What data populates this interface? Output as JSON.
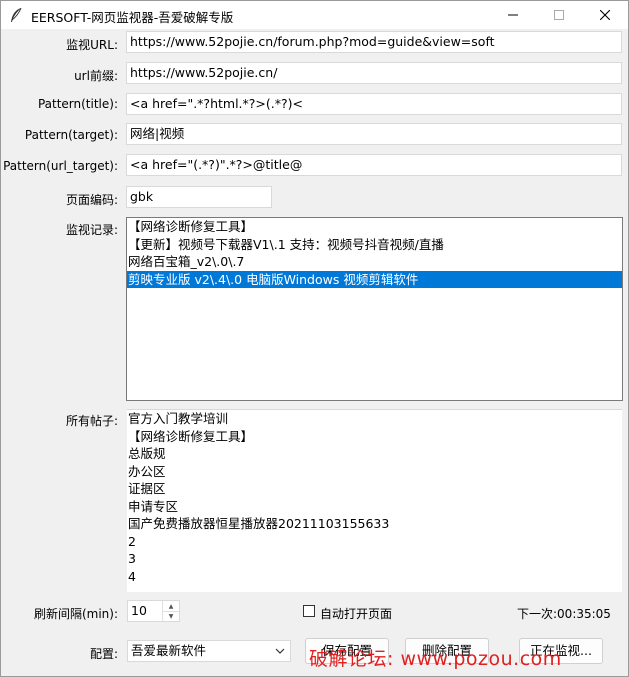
{
  "window": {
    "title": "EERSOFT-网页监视器-吾爱破解专版",
    "controls": {
      "minimize": "—",
      "maximize": "☐",
      "close": "✕"
    }
  },
  "form": {
    "monitor_url_label": "监视URL:",
    "monitor_url_value": "https://www.52pojie.cn/forum.php?mod=guide&view=soft",
    "url_prefix_label": "url前缀:",
    "url_prefix_value": "https://www.52pojie.cn/",
    "pattern_title_label": "Pattern(title):",
    "pattern_title_value": "<a href=\".*?html.*?>(.*?)<",
    "pattern_target_label": "Pattern(target):",
    "pattern_target_value": "网络|视频",
    "pattern_url_target_label": "Pattern(url_target):",
    "pattern_url_target_value": "<a href=\"(.*?)\".*?>@title@",
    "encoding_label": "页面编码:",
    "encoding_value": "gbk"
  },
  "records": {
    "label": "监视记录:",
    "items": [
      "【网络诊断修复工具】",
      "【更新】视频号下载器V1\\.1 支持：视频号抖音视频/直播",
      "网络百宝箱_v2\\.0\\.7",
      "剪映专业版 v2\\.4\\.0 电脑版Windows  视频剪辑软件"
    ],
    "selected_index": 3
  },
  "posts": {
    "label": "所有帖子:",
    "items": [
      "官方入门教学培训",
      "【网络诊断修复工具】",
      "总版规",
      "办公区",
      "证据区",
      "申请专区",
      "国产免费播放器恒星播放器20211103155633",
      "2",
      "3",
      "4"
    ]
  },
  "refresh": {
    "label": "刷新间隔(min):",
    "value": "10"
  },
  "auto_open": {
    "label": "自动打开页面",
    "checked": false
  },
  "next_run": "下一次:00:35:05",
  "config": {
    "label": "配置:",
    "selected": "吾爱最新软件"
  },
  "buttons": {
    "save": "保存配置",
    "delete": "删除配置",
    "monitoring": "正在监视..."
  },
  "watermark": "破解论坛: www.pozou.com"
}
